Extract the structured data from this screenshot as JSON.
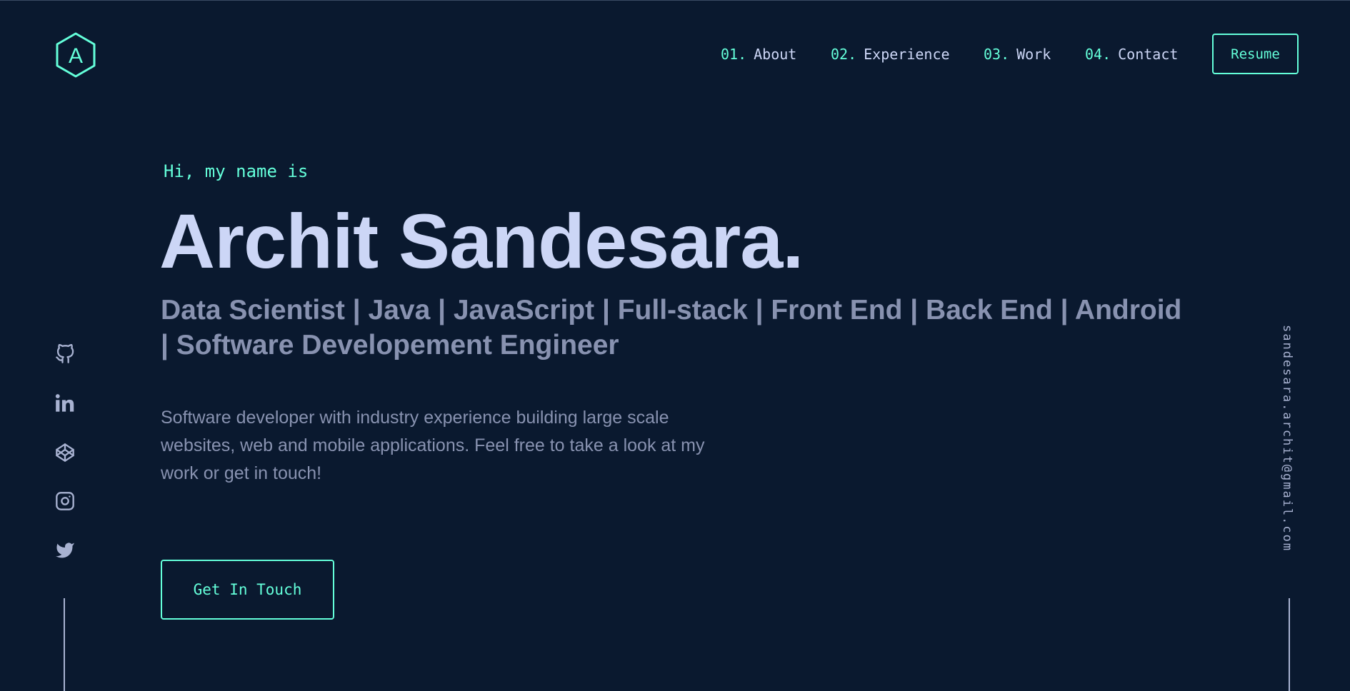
{
  "logo": {
    "letter": "A",
    "icon": "hexagon-logo-icon"
  },
  "nav": {
    "items": [
      {
        "num": "01.",
        "label": "About"
      },
      {
        "num": "02.",
        "label": "Experience"
      },
      {
        "num": "03.",
        "label": "Work"
      },
      {
        "num": "04.",
        "label": "Contact"
      }
    ],
    "resume_label": "Resume"
  },
  "hero": {
    "greeting": "Hi, my name is",
    "name": "Archit Sandesara.",
    "subtitle": "Data Scientist | Java | JavaScript | Full-stack | Front End | Back End | Android | Software Developement Engineer",
    "description": "Software developer with industry experience building large scale websites, web and mobile applications. Feel free to take a look at my work or get in touch!",
    "cta_label": "Get In Touch"
  },
  "social": [
    "github-icon",
    "linkedin-icon",
    "codepen-icon",
    "instagram-icon",
    "twitter-icon"
  ],
  "email": "sandesara.archit@gmail.com",
  "colors": {
    "background": "#0a192f",
    "accent": "#64ffda",
    "heading": "#ccd6f6",
    "text": "#8892b0"
  }
}
